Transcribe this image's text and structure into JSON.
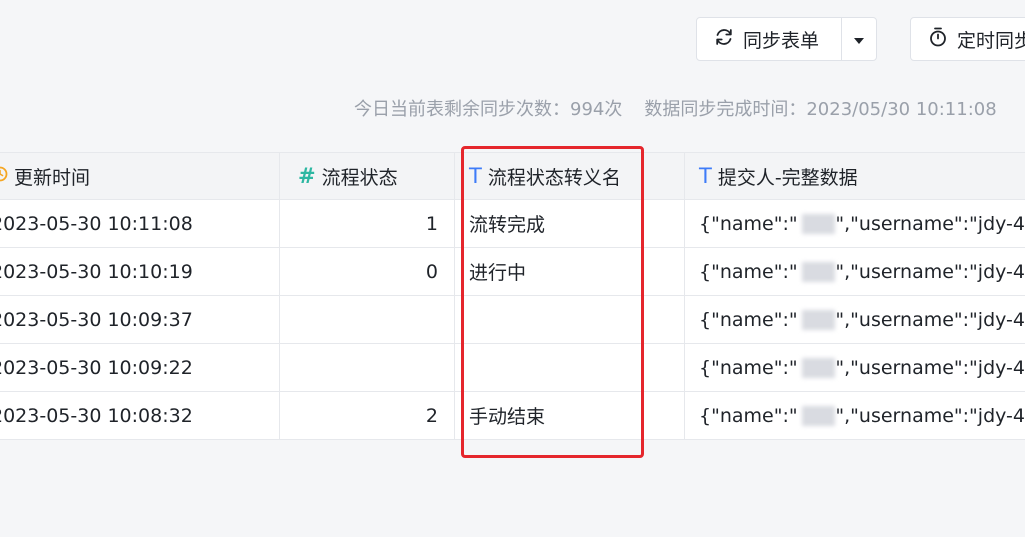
{
  "toolbar": {
    "sync_button_label": "同步表单",
    "timer_button_label": "定时同步"
  },
  "status": {
    "remaining": "今日当前表剩余同步次数：994次",
    "finished": "数据同步完成时间：2023/05/30 10:11:08"
  },
  "table": {
    "headers": {
      "updated": "更新时间",
      "flow_status": "流程状态",
      "flow_status_alias": "流程状态转义名",
      "submitter": "提交人-完整数据"
    },
    "rows": [
      {
        "updated": "2023-05-30 10:11:08",
        "flow_status": "1",
        "alias": "流转完成",
        "submitter_prefix": "{\"name\":\"",
        "submitter_suffix": "\",\"username\":\"jdy-4"
      },
      {
        "updated": "2023-05-30 10:10:19",
        "flow_status": "0",
        "alias": "进行中",
        "submitter_prefix": "{\"name\":\"",
        "submitter_suffix": "\",\"username\":\"jdy-4"
      },
      {
        "updated": "2023-05-30 10:09:37",
        "flow_status": "",
        "alias": "",
        "submitter_prefix": "{\"name\":\"",
        "submitter_suffix": "\",\"username\":\"jdy-4"
      },
      {
        "updated": "2023-05-30 10:09:22",
        "flow_status": "",
        "alias": "",
        "submitter_prefix": "{\"name\":\"",
        "submitter_suffix": "\",\"username\":\"jdy-4"
      },
      {
        "updated": "2023-05-30 10:08:32",
        "flow_status": "2",
        "alias": "手动结束",
        "submitter_prefix": "{\"name\":\"",
        "submitter_suffix": "\",\"username\":\"jdy-4"
      }
    ]
  },
  "colors": {
    "highlight": "#e5262c",
    "number_icon": "#2db7a2",
    "text_icon": "#3e7bf8",
    "clock_icon": "#f5a623"
  }
}
